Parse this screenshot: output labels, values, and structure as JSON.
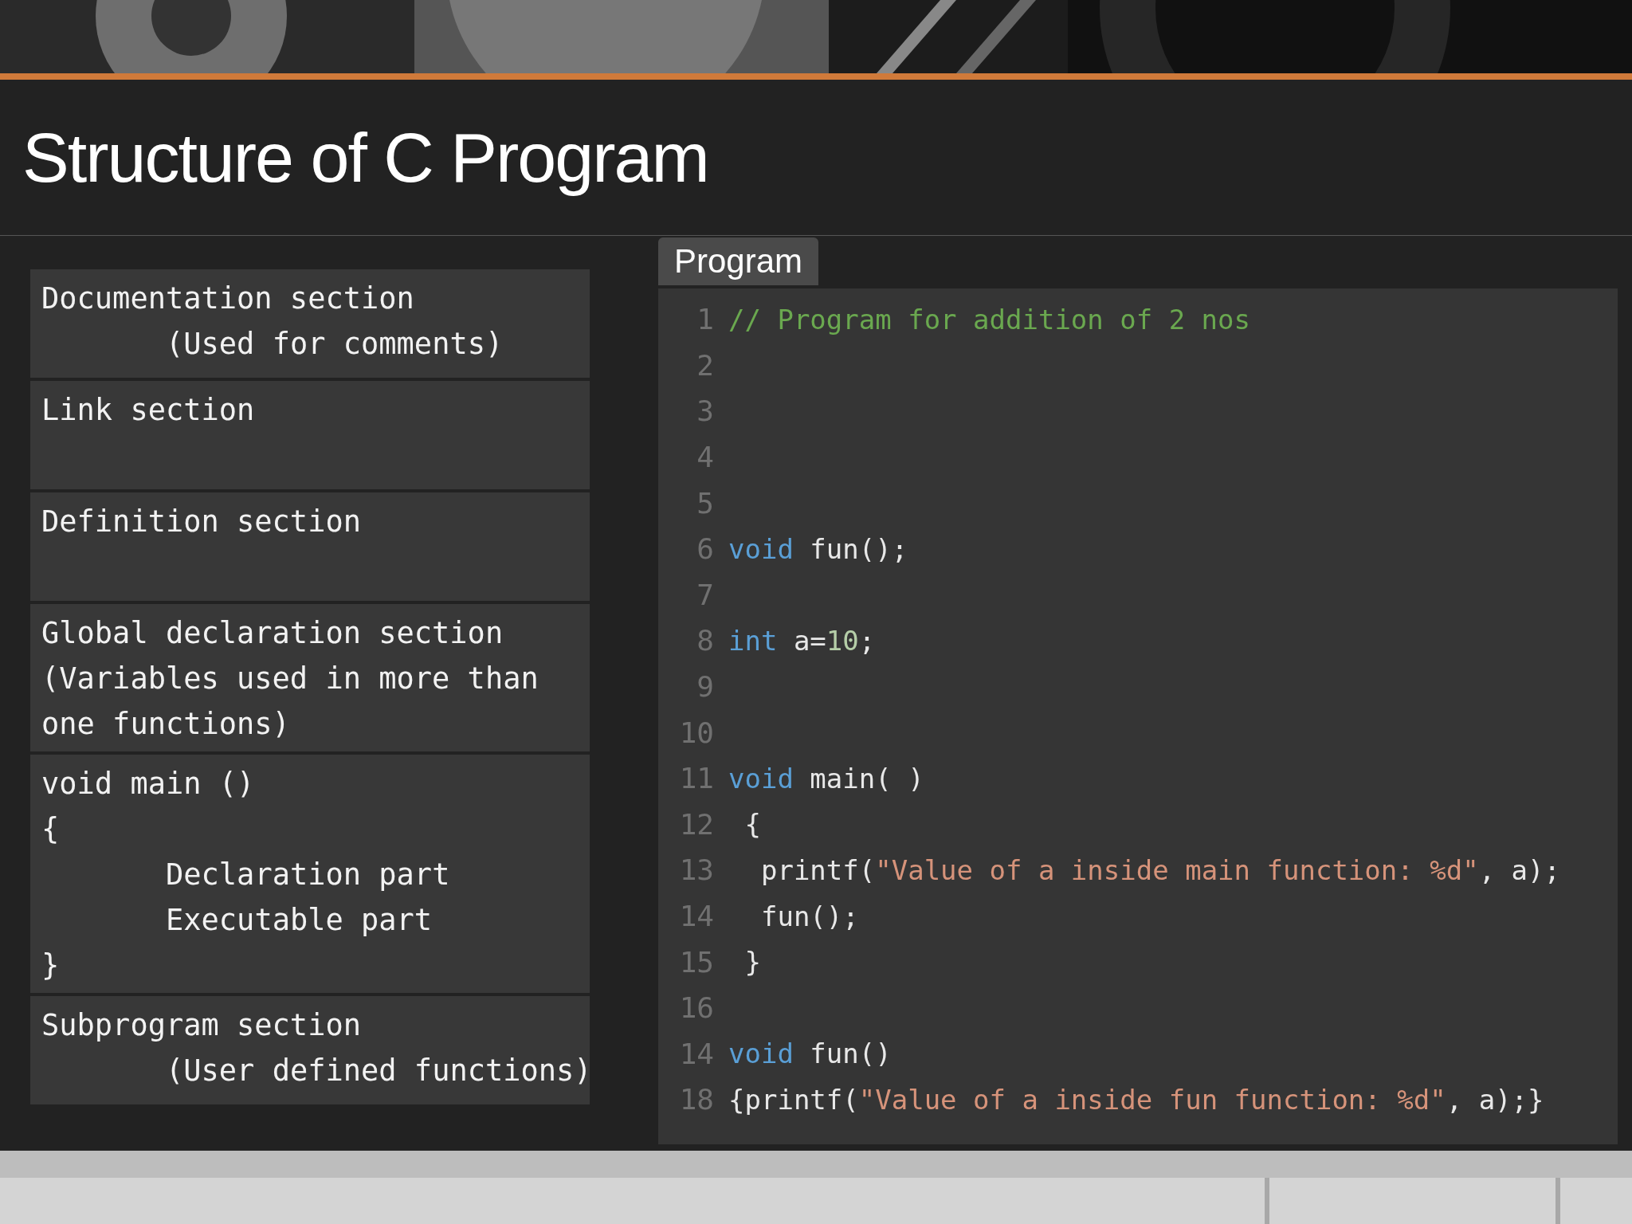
{
  "slide": {
    "title": "Structure of C Program"
  },
  "sections": [
    {
      "lines": [
        {
          "text": "Documentation section",
          "indented": false
        },
        {
          "text": "(Used for comments)",
          "indented": true
        }
      ]
    },
    {
      "lines": [
        {
          "text": "Link section",
          "indented": false
        }
      ]
    },
    {
      "lines": [
        {
          "text": "Definition section",
          "indented": false
        }
      ]
    },
    {
      "lines": [
        {
          "text": "Global declaration section",
          "indented": false
        },
        {
          "text": "(Variables used in more than",
          "indented": false
        },
        {
          "text": "one functions)",
          "indented": false
        }
      ]
    },
    {
      "lines": [
        {
          "text": "void main ()",
          "indented": false
        },
        {
          "text": "{",
          "indented": false
        },
        {
          "text": "Declaration part",
          "indented": true
        },
        {
          "text": "Executable part",
          "indented": true
        },
        {
          "text": "}",
          "indented": false
        }
      ]
    },
    {
      "lines": [
        {
          "text": "Subprogram section",
          "indented": false
        },
        {
          "text": "(User defined functions)",
          "indented": true
        }
      ]
    }
  ],
  "code_panel": {
    "tab": "Program",
    "lines": [
      {
        "number": "1",
        "tokens": [
          {
            "kind": "comment",
            "text": "// Program for addition of 2 nos"
          }
        ]
      },
      {
        "number": "2"
      },
      {
        "number": "3"
      },
      {
        "number": "4"
      },
      {
        "number": "5"
      },
      {
        "number": "6",
        "tokens": [
          {
            "kind": "keyword",
            "text": "void"
          },
          {
            "kind": "plain",
            "text": " fun();"
          }
        ]
      },
      {
        "number": "7"
      },
      {
        "number": "8",
        "tokens": [
          {
            "kind": "keyword",
            "text": "int"
          },
          {
            "kind": "plain",
            "text": " a="
          },
          {
            "kind": "number",
            "text": "10"
          },
          {
            "kind": "plain",
            "text": ";"
          }
        ]
      },
      {
        "number": "9"
      },
      {
        "number": "10"
      },
      {
        "number": "11",
        "tokens": [
          {
            "kind": "keyword",
            "text": "void"
          },
          {
            "kind": "plain",
            "text": " main( )"
          }
        ]
      },
      {
        "number": "12",
        "tokens": [
          {
            "kind": "plain",
            "text": " {"
          }
        ]
      },
      {
        "number": "13",
        "tokens": [
          {
            "kind": "plain",
            "text": "  printf("
          },
          {
            "kind": "string",
            "text": "\"Value of a inside main function: %d\""
          },
          {
            "kind": "plain",
            "text": ", a);"
          }
        ]
      },
      {
        "number": "14",
        "tokens": [
          {
            "kind": "plain",
            "text": "  fun();"
          }
        ]
      },
      {
        "number": "15",
        "tokens": [
          {
            "kind": "plain",
            "text": " }"
          }
        ]
      },
      {
        "number": "16"
      },
      {
        "number": "14",
        "tokens": [
          {
            "kind": "keyword",
            "text": "void"
          },
          {
            "kind": "plain",
            "text": " fun()"
          }
        ]
      },
      {
        "number": "18",
        "tokens": [
          {
            "kind": "plain",
            "text": "{printf("
          },
          {
            "kind": "string",
            "text": "\"Value of a inside fun function: %d\""
          },
          {
            "kind": "plain",
            "text": ", a);}"
          }
        ]
      }
    ]
  }
}
